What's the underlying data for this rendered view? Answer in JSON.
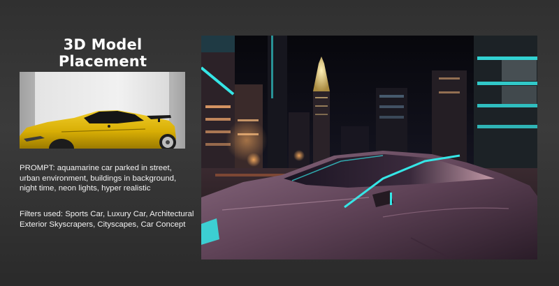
{
  "slide": {
    "title": "3D Model Placement",
    "prompt_text": "PROMPT: aquamarine car parked in street, urban environment, buildings in background, night time,  neon lights, hyper realistic",
    "filters_text": "Filters used: Sports Car, Luxury Car, Architectural Exterior Skyscrapers, Cityscapes, Car Concept"
  },
  "colors": {
    "background": "#333333",
    "model_car": "#d9b200",
    "neon_accent": "#35e6e6",
    "render_car": "#6a4a5e"
  },
  "images": {
    "model_thumbnail": "yellow-sports-car-3d-model",
    "render_output": "neon-city-sports-car-render"
  }
}
